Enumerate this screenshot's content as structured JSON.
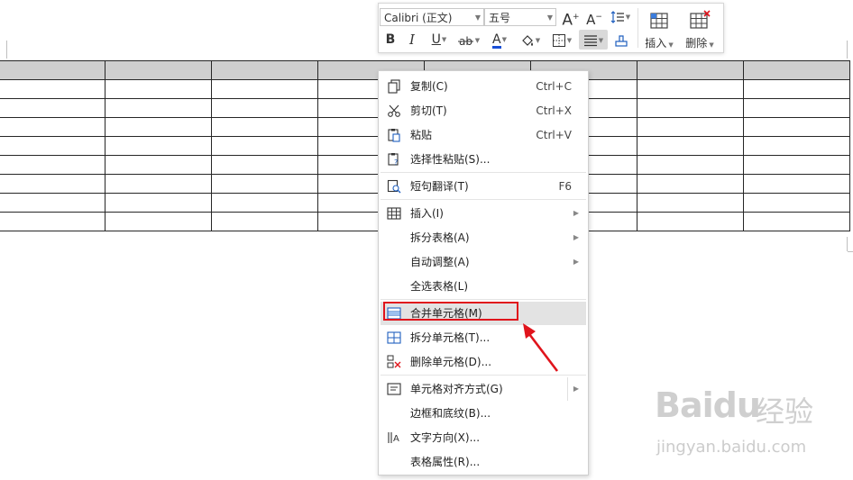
{
  "toolbar": {
    "font_name": "Calibri (正文)",
    "font_size": "五号",
    "grow_label": "A",
    "shrink_label": "A",
    "bold_label": "B",
    "italic_label": "I",
    "underline_label": "U",
    "font_color_label": "A",
    "insert_label": "插入",
    "delete_label": "删除"
  },
  "context_menu": {
    "items": [
      {
        "label": "复制(C)",
        "shortcut": "Ctrl+C",
        "icon": "copy-icon"
      },
      {
        "label": "剪切(T)",
        "shortcut": "Ctrl+X",
        "icon": "cut-icon"
      },
      {
        "label": "粘贴",
        "shortcut": "Ctrl+V",
        "icon": "paste-icon"
      },
      {
        "label": "选择性粘贴(S)...",
        "shortcut": "",
        "icon": "paste-special-icon"
      },
      {
        "label": "短句翻译(T)",
        "shortcut": "F6",
        "icon": "translate-icon"
      },
      {
        "label": "插入(I)",
        "shortcut": "",
        "icon": "table-insert-icon",
        "submenu": true
      },
      {
        "label": "拆分表格(A)",
        "shortcut": "",
        "icon": "",
        "submenu": true
      },
      {
        "label": "自动调整(A)",
        "shortcut": "",
        "icon": "",
        "submenu": true
      },
      {
        "label": "全选表格(L)",
        "shortcut": "",
        "icon": ""
      },
      {
        "label": "合并单元格(M)",
        "shortcut": "",
        "icon": "merge-cells-icon",
        "highlighted": true
      },
      {
        "label": "拆分单元格(T)...",
        "shortcut": "",
        "icon": "split-cells-icon"
      },
      {
        "label": "删除单元格(D)...",
        "shortcut": "",
        "icon": "delete-cells-icon"
      },
      {
        "label": "单元格对齐方式(G)",
        "shortcut": "",
        "icon": "cell-align-icon",
        "submenu": true
      },
      {
        "label": "边框和底纹(B)...",
        "shortcut": "",
        "icon": ""
      },
      {
        "label": "文字方向(X)...",
        "shortcut": "",
        "icon": "text-direction-icon"
      },
      {
        "label": "表格属性(R)...",
        "shortcut": "",
        "icon": ""
      }
    ]
  },
  "table": {
    "columns": 8,
    "rows": 9
  },
  "watermark": {
    "logo": "Baidu",
    "name": "经验",
    "url": "jingyan.baidu.com"
  },
  "colors": {
    "highlight": "#e0141c",
    "header_fill": "#cfcfcf",
    "hover": "#e3e3e3"
  }
}
